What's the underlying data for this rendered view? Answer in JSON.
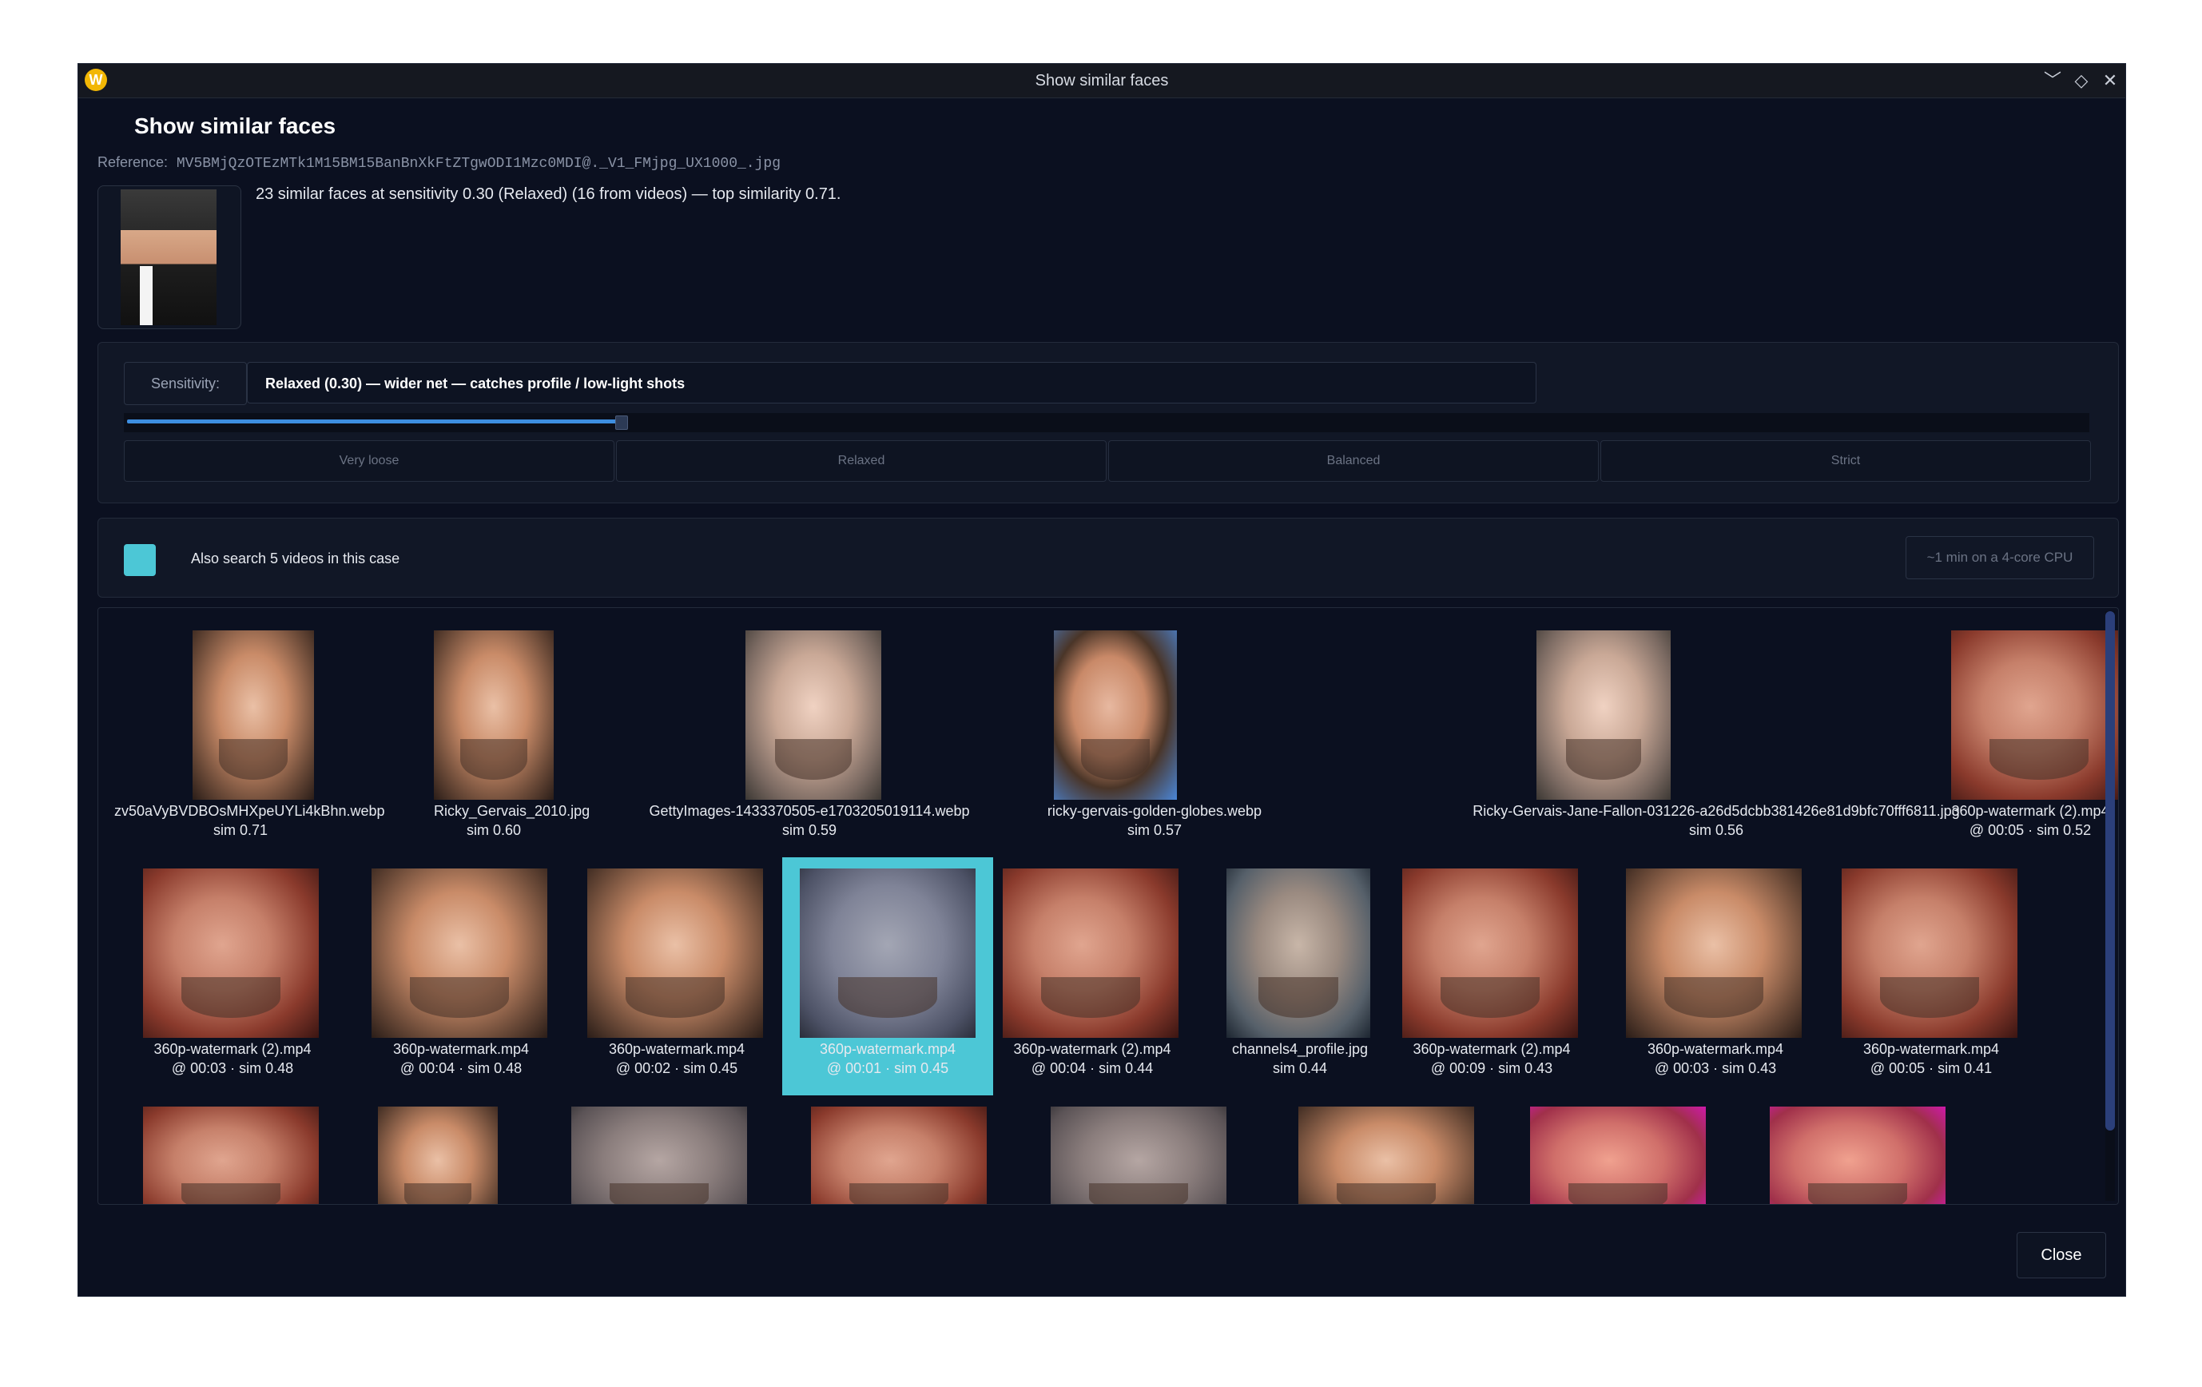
{
  "window": {
    "title": "Show similar faces",
    "app_icon": "W",
    "controls": {
      "minimize": "﹀",
      "maximize": "◇",
      "close": "✕"
    }
  },
  "dialog": {
    "title": "Show similar faces",
    "reference_label": "Reference:",
    "reference_file": "MV5BMjQzOTEzMTk1M15BM15BanBnXkFtZTgwODI1Mzc0MDI@._V1_FMjpg_UX1000_.jpg",
    "summary": "23 similar faces at sensitivity 0.30 (Relaxed) (16 from videos) — top similarity 0.71."
  },
  "sensitivity": {
    "label": "Sensitivity:",
    "selected": "Relaxed (0.30) — wider net — catches profile / low-light shots",
    "value": 0.25,
    "presets": [
      "Very loose",
      "Relaxed",
      "Balanced",
      "Strict"
    ]
  },
  "video_search": {
    "checked": true,
    "label": "Also search 5 videos in this case",
    "estimate": "~1 min on a 4-core CPU"
  },
  "results": [
    {
      "name": "zv50aVyBVDBOsMHXpeUYLi4kBhn.webp",
      "info": "sim 0.71",
      "tone": "warm"
    },
    {
      "name": "Ricky_Gervais_2010.jpg",
      "info": "sim 0.60",
      "tone": "warm"
    },
    {
      "name": "GettyImages-1433370505-e1703205019114.webp",
      "info": "sim 0.59",
      "tone": "pale"
    },
    {
      "name": "ricky-gervais-golden-globes.webp",
      "info": "sim 0.57",
      "tone": "bluebg"
    },
    {
      "name": "Ricky-Gervais-Jane-Fallon-031226-a26d5dcbb381426e81d9bfc70fff6811.jpg",
      "info": "sim 0.56",
      "tone": "pale"
    },
    {
      "name": "360p-watermark (2).mp4",
      "info": "@ 00:05 · sim 0.52",
      "tone": "reddish"
    },
    {
      "name": "360p-watermark (2).mp4",
      "info": "@ 00:03 · sim 0.48",
      "tone": "reddish"
    },
    {
      "name": "360p-watermark.mp4",
      "info": "@ 00:04 · sim 0.48",
      "tone": "warm"
    },
    {
      "name": "360p-watermark.mp4",
      "info": "@ 00:02 · sim 0.45",
      "tone": "warm"
    },
    {
      "name": "360p-watermark.mp4",
      "info": "@ 00:01 · sim 0.45",
      "tone": "selface",
      "selected": true
    },
    {
      "name": "360p-watermark (2).mp4",
      "info": "@ 00:04 · sim 0.44",
      "tone": "reddish"
    },
    {
      "name": "channels4_profile.jpg",
      "info": "sim 0.44",
      "tone": "grey"
    },
    {
      "name": "360p-watermark (2).mp4",
      "info": "@ 00:09 · sim 0.43",
      "tone": "reddish"
    },
    {
      "name": "360p-watermark.mp4",
      "info": "@ 00:03 · sim 0.43",
      "tone": "warm"
    },
    {
      "name": "360p-watermark.mp4",
      "info": "@ 00:05 · sim 0.41",
      "tone": "reddish"
    },
    {
      "tone": "reddish"
    },
    {
      "tone": "warm"
    },
    {
      "tone": "muted"
    },
    {
      "tone": "reddish"
    },
    {
      "tone": "muted"
    },
    {
      "tone": "warm"
    },
    {
      "tone": "magenta"
    },
    {
      "tone": "magenta"
    }
  ],
  "footer": {
    "close_label": "Close"
  },
  "colors": {
    "accent": "#4cc7d6",
    "slider": "#3d8ee0",
    "scroll_thumb": "#2b3f7a",
    "background": "#0b1020"
  }
}
